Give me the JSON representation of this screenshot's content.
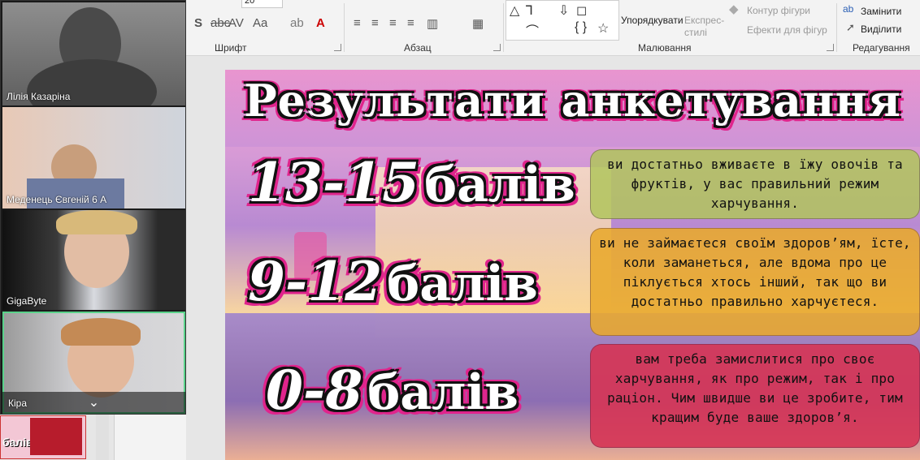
{
  "ribbon": {
    "font_group": "Шрифт",
    "font_size": "20",
    "paragraph_group": "Абзац",
    "drawing_group": "Малювання",
    "editing_group": "Редагування",
    "arrange": "Упорядкувати",
    "quick_styles": "Експрес-\nстилі",
    "shape_outline": "Контур фігури",
    "shape_effects": "Ефекти для фігур",
    "replace": "Замінити",
    "select": "Виділити"
  },
  "slide": {
    "title": "Результати анкетування",
    "results": [
      {
        "range": "13-15",
        "unit": "балів",
        "text": "ви достатньо вживаєте в їжу овочів та фруктів, у вас правильний режим харчування."
      },
      {
        "range": "9-12",
        "unit": "балів",
        "text": "ви не займаєтеся своїм здоров’ям, їсте, коли заманеться, але вдома про це піклується хтось інший, так що ви достатньо правильно харчуєтеся."
      },
      {
        "range": "0-8",
        "unit": "балів",
        "text": "вам треба замислитися про своє харчування, як про режим, так і про раціон. Чим швидше ви це зробите, тим кращим буде ваше здоров’я."
      }
    ]
  },
  "participants": [
    {
      "name": "Лілія Казаріна"
    },
    {
      "name": "Меденець Євгеній 6 А"
    },
    {
      "name": "GigaByte"
    },
    {
      "name": "Кіра"
    }
  ],
  "thumb": {
    "label": "балів"
  },
  "colors": {
    "active_speaker": "#5ad28a",
    "accent": "#e0248c"
  }
}
